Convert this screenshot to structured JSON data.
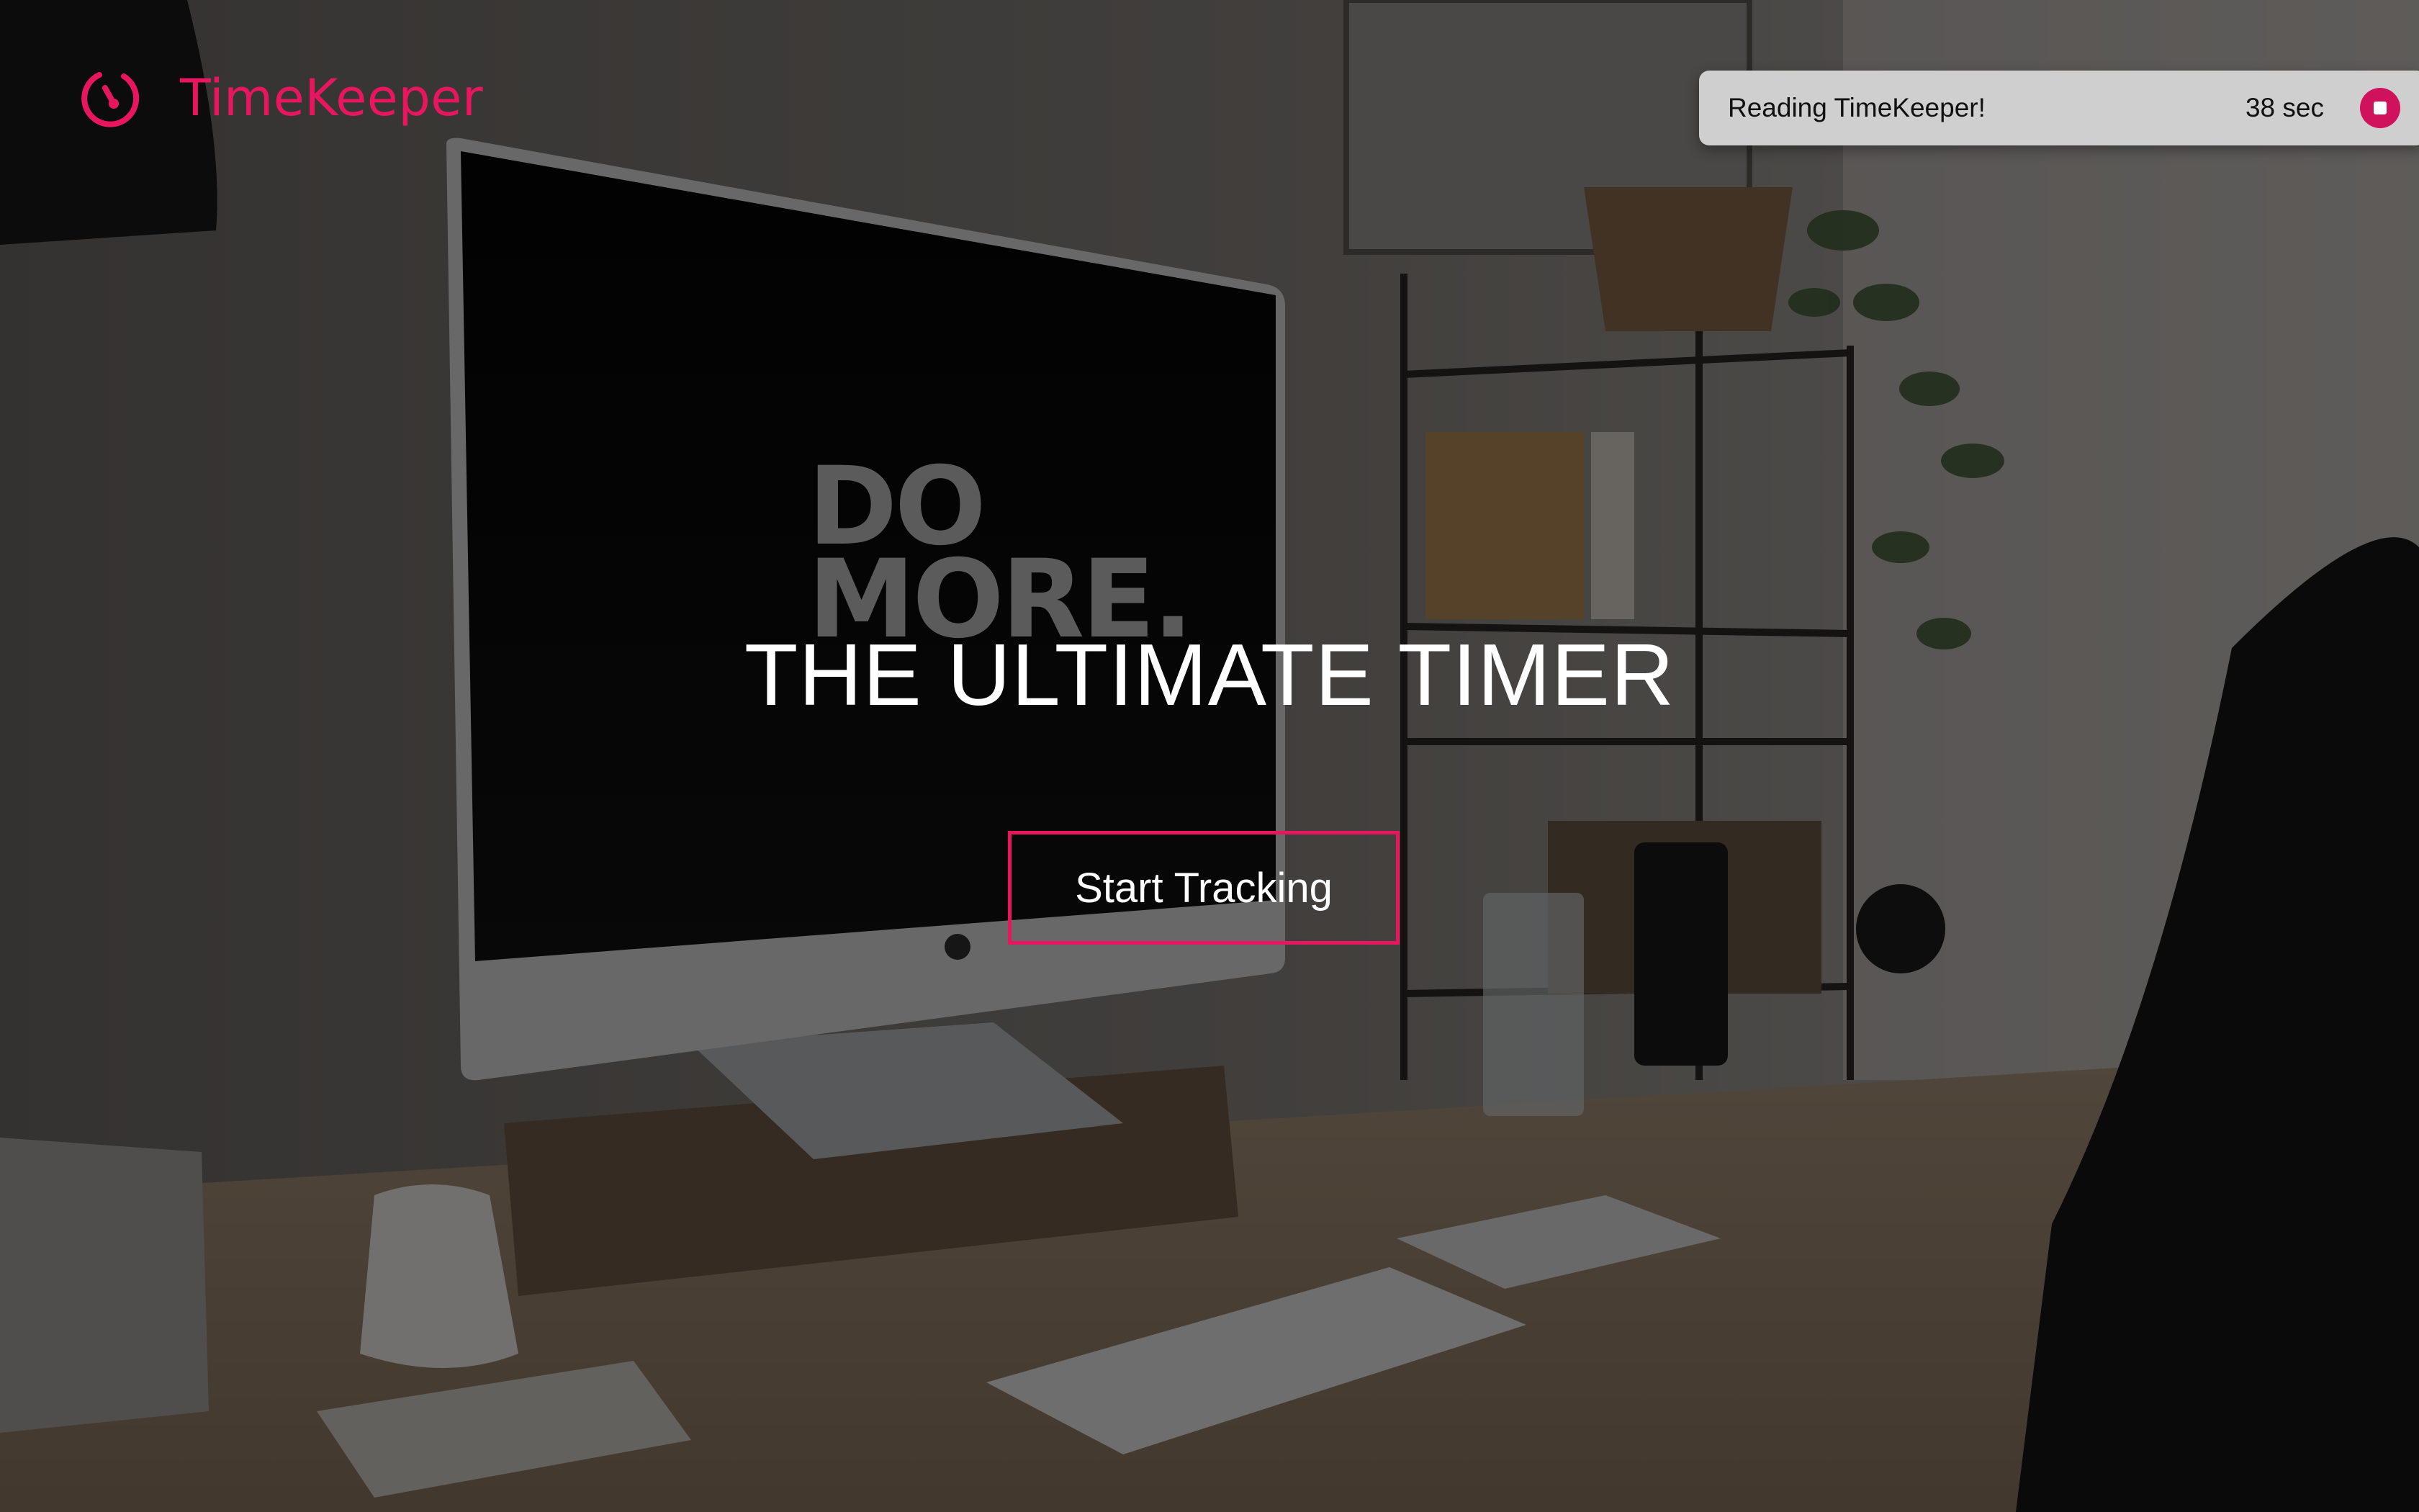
{
  "brand": {
    "name": "TimeKeeper",
    "icon": "stopwatch-icon",
    "color": "#e8165f"
  },
  "reading_widget": {
    "message": "Reading TimeKeeper!",
    "elapsed": "38 sec",
    "stop_icon": "stop-icon",
    "stop_color": "#d0115c"
  },
  "hero": {
    "title": "THE ULTIMATE TIMER",
    "cta_label": "Start Tracking",
    "cta_border_color": "#e8165f",
    "monitor_text": [
      "DO",
      "MORE."
    ],
    "background": "desk-workspace-photo"
  }
}
